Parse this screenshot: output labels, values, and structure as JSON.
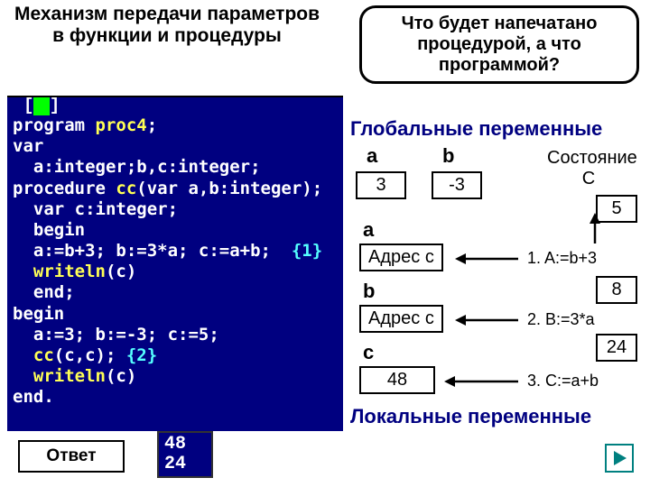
{
  "title_left": "Механизм передачи параметров  в функции и процедуры",
  "title_right": "Что будет напечатано процедурой, а что программой?",
  "editor": {
    "lines": [
      "program proc4;",
      "var",
      "  a:integer;b,c:integer;",
      "procedure cc(var a,b:integer);",
      "  var c:integer;",
      "  begin",
      "  a:=b+3; b:=3*a; c:=a+b;  {1}",
      "  writeln(c)",
      "  end;",
      "begin",
      "  a:=3; b:=-3; c:=5;",
      "  cc(c,c); {2}",
      "  writeln(c)",
      "end."
    ]
  },
  "answer_label": "Ответ",
  "outputs": [
    "48",
    "24"
  ],
  "globals": {
    "title": "Глобальные переменные",
    "a_label": "a",
    "a_value": "3",
    "b_label": "b",
    "b_value": "-3",
    "state_label": "Состояние  С",
    "state_value": "5",
    "step1_var": "a",
    "step1_addr": "Адрес с",
    "step1_text": "1.  A:=b+3",
    "step2_var": "b",
    "step2_addr": "Адрес с",
    "step2_text": "2.  B:=3*a",
    "step2_val": "8",
    "step3_var": "c",
    "step3_val": "48",
    "step3_text": "3.  C:=a+b",
    "step3_interim": "24"
  },
  "locals_title": "Локальные переменные"
}
